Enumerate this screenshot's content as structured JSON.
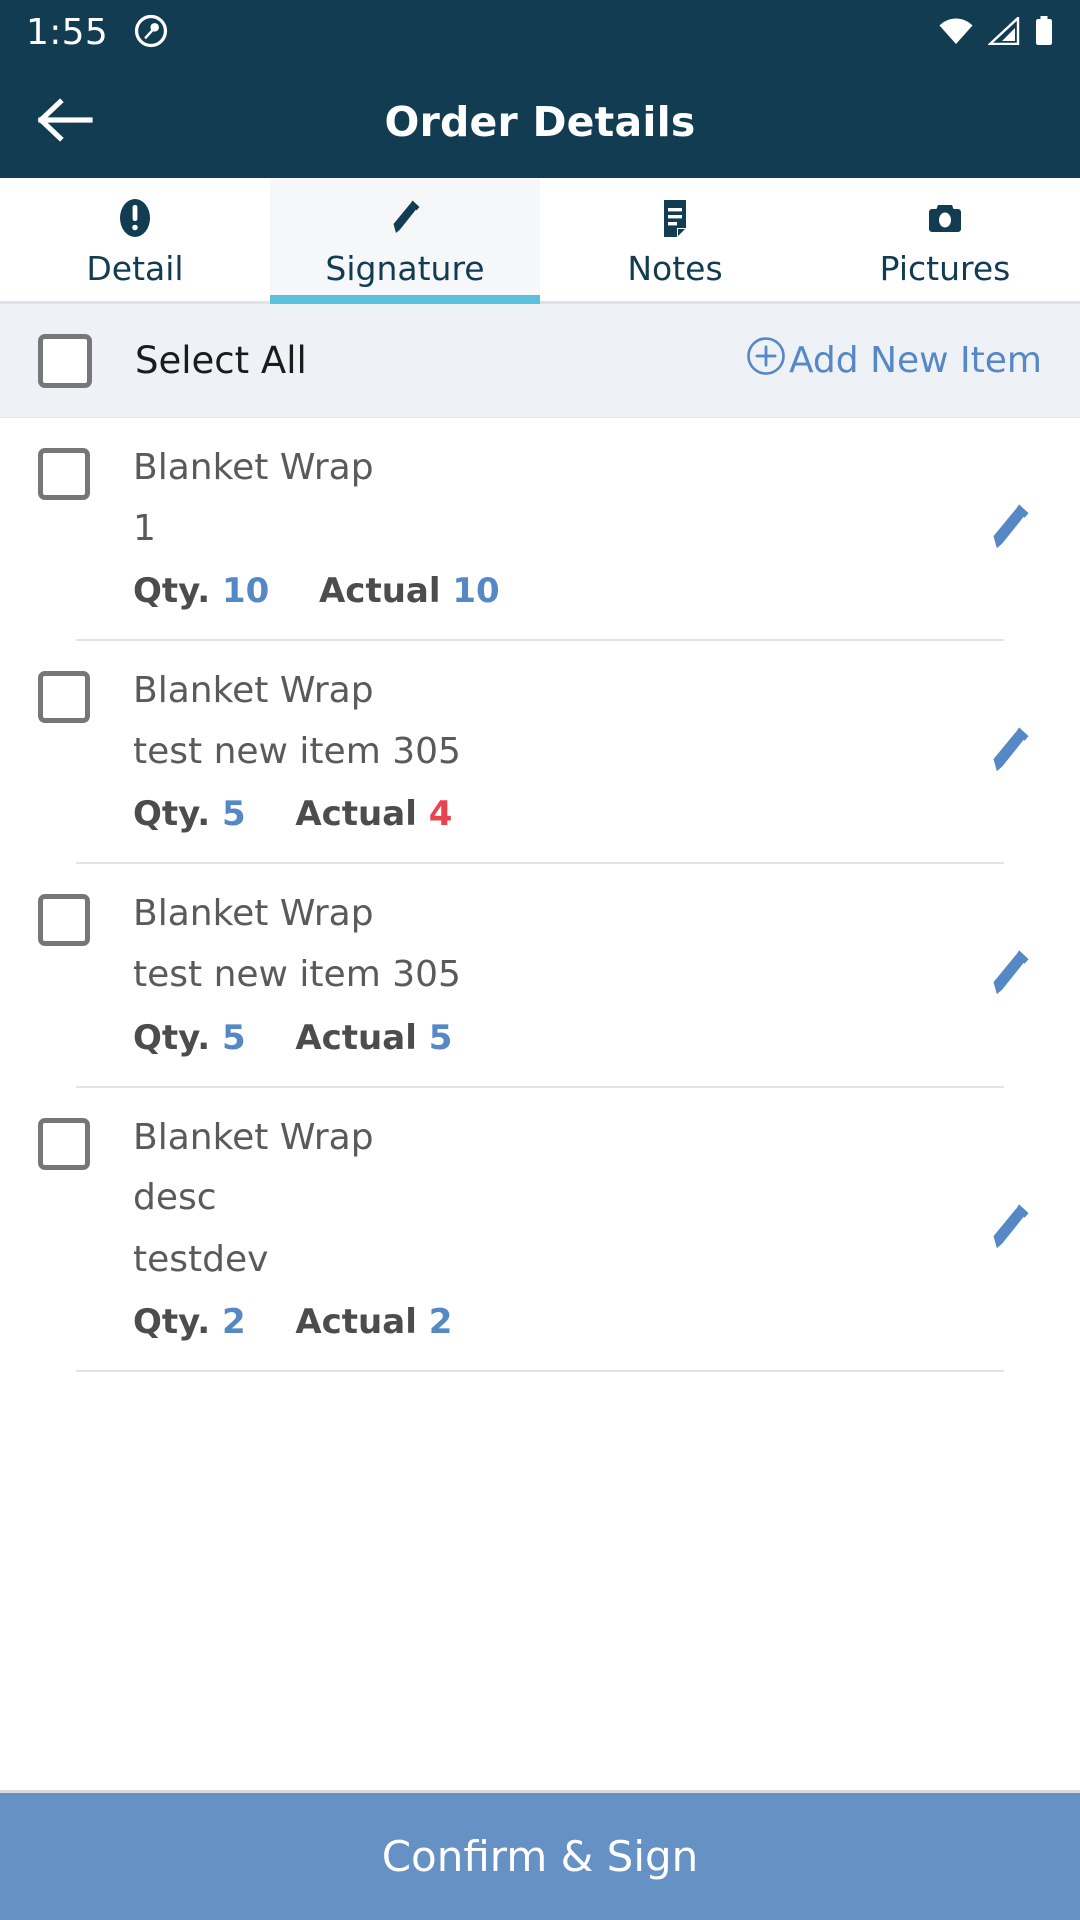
{
  "statusbar": {
    "time": "1:55",
    "icons": [
      "notification-circle-icon",
      "wifi-icon",
      "cell-signal-icon",
      "battery-icon"
    ]
  },
  "appbar": {
    "title": "Order Details",
    "back_icon": "back-arrow-icon"
  },
  "tabs": [
    {
      "label": "Detail",
      "icon": "exclamation-circle-icon",
      "active": false
    },
    {
      "label": "Signature",
      "icon": "pencil-icon",
      "active": true
    },
    {
      "label": "Notes",
      "icon": "note-document-icon",
      "active": false
    },
    {
      "label": "Pictures",
      "icon": "camera-icon",
      "active": false
    }
  ],
  "toolbar": {
    "select_all_label": "Select All",
    "select_all_checked": false,
    "add_new_label": "Add New Item",
    "add_new_icon": "plus-circle-icon"
  },
  "labels": {
    "qty": "Qty.",
    "actual": "Actual"
  },
  "items": [
    {
      "name": "Blanket Wrap",
      "desc1": "1",
      "desc2": "",
      "qty": "10",
      "actual": "10",
      "actual_mismatch": false,
      "checked": false
    },
    {
      "name": "Blanket Wrap",
      "desc1": "test new item 305",
      "desc2": "",
      "qty": "5",
      "actual": "4",
      "actual_mismatch": true,
      "checked": false
    },
    {
      "name": "Blanket Wrap",
      "desc1": "test new item 305",
      "desc2": "",
      "qty": "5",
      "actual": "5",
      "actual_mismatch": false,
      "checked": false
    },
    {
      "name": "Blanket Wrap",
      "desc1": "desc",
      "desc2": "testdev",
      "qty": "2",
      "actual": "2",
      "actual_mismatch": false,
      "checked": false
    }
  ],
  "footer": {
    "confirm_label": "Confirm & Sign"
  },
  "colors": {
    "header_bg": "#123C52",
    "accent_blue": "#5588c4",
    "active_underline": "#5BC0DE",
    "error_red": "#e8434f",
    "confirm_bg": "#6591c4",
    "toolbar_bg": "#eef1f6"
  }
}
